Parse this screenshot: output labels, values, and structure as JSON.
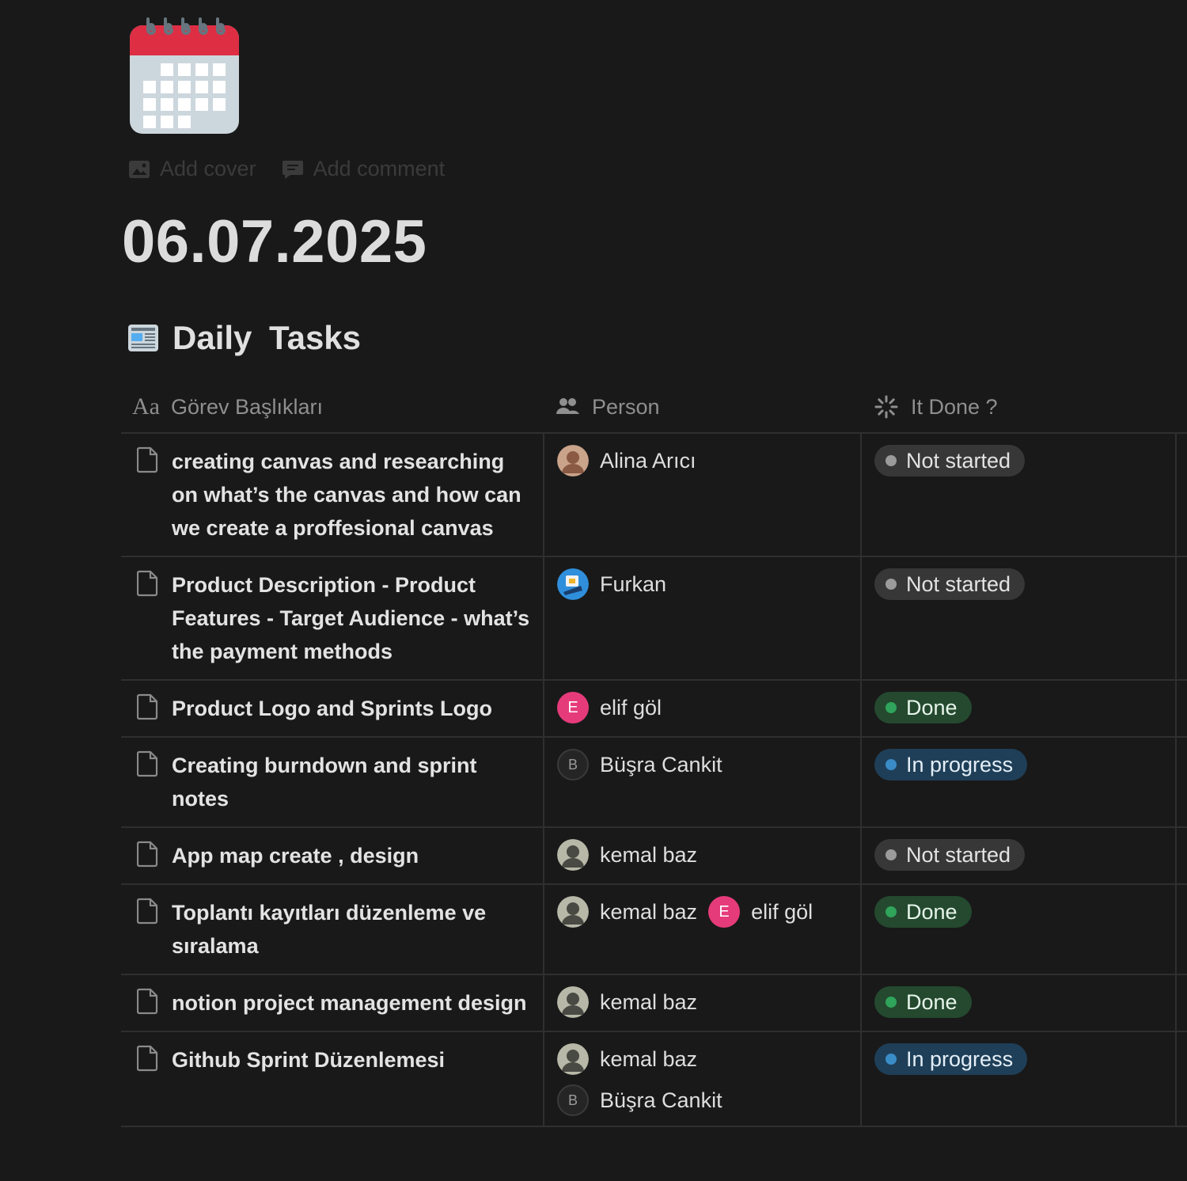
{
  "page": {
    "icon": "calendar-icon",
    "actions": [
      {
        "label": "Add cover",
        "icon": "image-icon"
      },
      {
        "label": "Add comment",
        "icon": "comment-icon"
      }
    ],
    "title": "06.07.2025"
  },
  "database": {
    "icon": "newspaper-icon",
    "title": "Daily  Tasks",
    "columns": [
      {
        "label": "Görev Başlıkları",
        "icon": "Aa"
      },
      {
        "label": "Person",
        "icon": "people-icon"
      },
      {
        "label": "It Done ?",
        "icon": "status-spinner-icon"
      }
    ],
    "rows": [
      {
        "title": "creating canvas and researching on what’s the canvas and how can we create a proffesional canvas",
        "people": [
          {
            "name": "Alina Arıcı",
            "avatar": "photo"
          }
        ],
        "status": "Not started",
        "status_color": "#373737"
      },
      {
        "title": "Product Description - Product Features - Target Audience - what’s the payment methods",
        "people": [
          {
            "name": "Furkan",
            "avatar": "illustration"
          }
        ],
        "status": "Not started",
        "status_color": "#373737"
      },
      {
        "title": "Product Logo and Sprints Logo",
        "people": [
          {
            "name": "elif göl",
            "avatar": "E"
          }
        ],
        "status": "Done",
        "status_color": "#24492f"
      },
      {
        "title": "Creating burndown and sprint notes",
        "people": [
          {
            "name": "Büşra Cankit",
            "avatar": "B"
          }
        ],
        "status": "In progress",
        "status_color": "#1f3f58"
      },
      {
        "title": "App map create , design",
        "people": [
          {
            "name": "kemal baz",
            "avatar": "photo"
          }
        ],
        "status": "Not started",
        "status_color": "#373737"
      },
      {
        "title": "Toplantı kayıtları düzenleme ve sıralama",
        "people": [
          {
            "name": "kemal baz",
            "avatar": "photo"
          },
          {
            "name": "elif göl",
            "avatar": "E"
          }
        ],
        "status": "Done",
        "status_color": "#24492f"
      },
      {
        "title": "notion project management design",
        "people": [
          {
            "name": "kemal baz",
            "avatar": "photo"
          }
        ],
        "status": "Done",
        "status_color": "#24492f"
      },
      {
        "title": "Github Sprint Düzenlemesi",
        "people": [
          {
            "name": "kemal baz",
            "avatar": "photo"
          },
          {
            "name": "Büşra Cankit",
            "avatar": "B"
          }
        ],
        "status": "In progress",
        "status_color": "#1f3f58"
      }
    ]
  }
}
